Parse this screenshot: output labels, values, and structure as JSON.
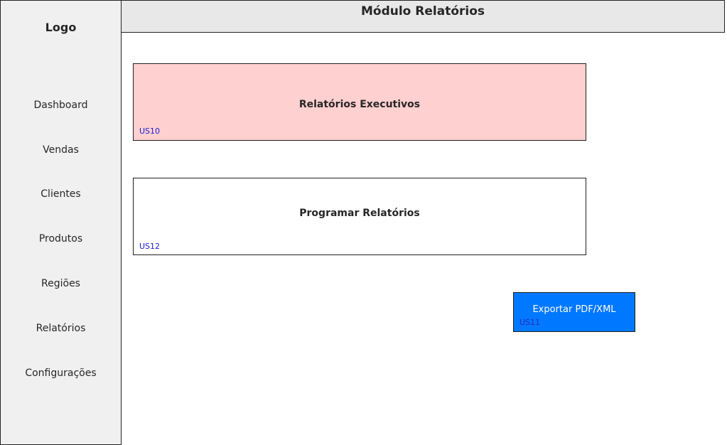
{
  "sidebar": {
    "logo": "Logo",
    "items": [
      {
        "label": "Dashboard"
      },
      {
        "label": "Vendas"
      },
      {
        "label": "Clientes"
      },
      {
        "label": "Produtos"
      },
      {
        "label": "Regiões"
      },
      {
        "label": "Relatórios"
      },
      {
        "label": "Configurações"
      }
    ]
  },
  "header": {
    "title": "Módulo Relatórios"
  },
  "main": {
    "executive_reports": {
      "title": "Relatórios Executivos",
      "tag": "US10",
      "background": "#ffd0d0"
    },
    "schedule_reports": {
      "title": "Programar Relatórios",
      "tag": "US12"
    },
    "export_button": {
      "label": "Exportar PDF/XML",
      "tag": "US11",
      "background": "#0078ff"
    }
  }
}
